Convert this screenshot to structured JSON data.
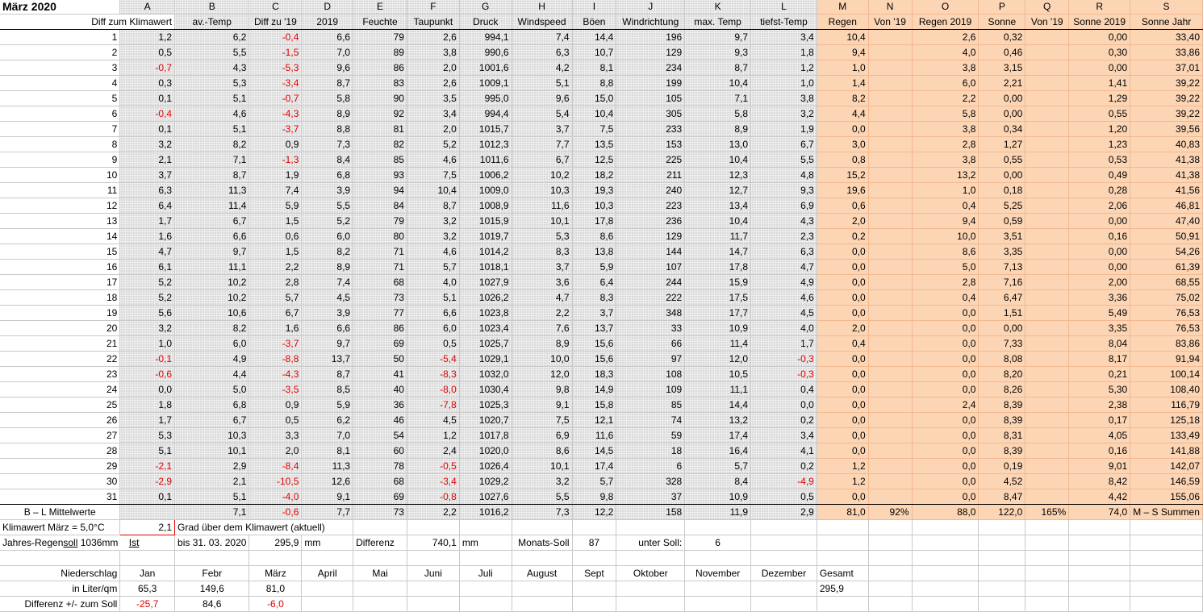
{
  "title": "März 2020",
  "col_letters": [
    "A",
    "B",
    "C",
    "D",
    "E",
    "F",
    "G",
    "H",
    "I",
    "J",
    "K",
    "L",
    "M",
    "N",
    "O",
    "P",
    "Q",
    "R",
    "S"
  ],
  "col_headers": [
    "Diff zum Klimawert",
    "av.-Temp",
    "Diff zu '19",
    "2019",
    "Feuchte",
    "Taupunkt",
    "Druck",
    "Windspeed",
    "Böen",
    "Windrichtung",
    "max. Temp",
    "tiefst-Temp",
    "Regen",
    "Von '19",
    "Regen 2019",
    "Sonne",
    "Von '19",
    "Sonne 2019",
    "Sonne Jahr"
  ],
  "rows": [
    [
      "1",
      "1,2",
      "6,2",
      "-0,4",
      "6,6",
      "79",
      "2,6",
      "994,1",
      "7,4",
      "14,4",
      "196",
      "9,7",
      "3,4",
      "10,4",
      "",
      "2,6",
      "0,32",
      "",
      "0,00",
      "33,40"
    ],
    [
      "2",
      "0,5",
      "5,5",
      "-1,5",
      "7,0",
      "89",
      "3,8",
      "990,6",
      "6,3",
      "10,7",
      "129",
      "9,3",
      "1,8",
      "9,4",
      "",
      "4,0",
      "0,46",
      "",
      "0,30",
      "33,86"
    ],
    [
      "3",
      "-0,7",
      "4,3",
      "-5,3",
      "9,6",
      "86",
      "2,0",
      "1001,6",
      "4,2",
      "8,1",
      "234",
      "8,7",
      "1,2",
      "1,0",
      "",
      "3,8",
      "3,15",
      "",
      "0,00",
      "37,01"
    ],
    [
      "4",
      "0,3",
      "5,3",
      "-3,4",
      "8,7",
      "83",
      "2,6",
      "1009,1",
      "5,1",
      "8,8",
      "199",
      "10,4",
      "1,0",
      "1,4",
      "",
      "6,0",
      "2,21",
      "",
      "1,41",
      "39,22"
    ],
    [
      "5",
      "0,1",
      "5,1",
      "-0,7",
      "5,8",
      "90",
      "3,5",
      "995,0",
      "9,6",
      "15,0",
      "105",
      "7,1",
      "3,8",
      "8,2",
      "",
      "2,2",
      "0,00",
      "",
      "1,29",
      "39,22"
    ],
    [
      "6",
      "-0,4",
      "4,6",
      "-4,3",
      "8,9",
      "92",
      "3,4",
      "994,4",
      "5,4",
      "10,4",
      "305",
      "5,8",
      "3,2",
      "4,4",
      "",
      "5,8",
      "0,00",
      "",
      "0,55",
      "39,22"
    ],
    [
      "7",
      "0,1",
      "5,1",
      "-3,7",
      "8,8",
      "81",
      "2,0",
      "1015,7",
      "3,7",
      "7,5",
      "233",
      "8,9",
      "1,9",
      "0,0",
      "",
      "3,8",
      "0,34",
      "",
      "1,20",
      "39,56"
    ],
    [
      "8",
      "3,2",
      "8,2",
      "0,9",
      "7,3",
      "82",
      "5,2",
      "1012,3",
      "7,7",
      "13,5",
      "153",
      "13,0",
      "6,7",
      "3,0",
      "",
      "2,8",
      "1,27",
      "",
      "1,23",
      "40,83"
    ],
    [
      "9",
      "2,1",
      "7,1",
      "-1,3",
      "8,4",
      "85",
      "4,6",
      "1011,6",
      "6,7",
      "12,5",
      "225",
      "10,4",
      "5,5",
      "0,8",
      "",
      "3,8",
      "0,55",
      "",
      "0,53",
      "41,38"
    ],
    [
      "10",
      "3,7",
      "8,7",
      "1,9",
      "6,8",
      "93",
      "7,5",
      "1006,2",
      "10,2",
      "18,2",
      "211",
      "12,3",
      "4,8",
      "15,2",
      "",
      "13,2",
      "0,00",
      "",
      "0,49",
      "41,38"
    ],
    [
      "11",
      "6,3",
      "11,3",
      "7,4",
      "3,9",
      "94",
      "10,4",
      "1009,0",
      "10,3",
      "19,3",
      "240",
      "12,7",
      "9,3",
      "19,6",
      "",
      "1,0",
      "0,18",
      "",
      "0,28",
      "41,56"
    ],
    [
      "12",
      "6,4",
      "11,4",
      "5,9",
      "5,5",
      "84",
      "8,7",
      "1008,9",
      "11,6",
      "10,3",
      "223",
      "13,4",
      "6,9",
      "0,6",
      "",
      "0,4",
      "5,25",
      "",
      "2,06",
      "46,81"
    ],
    [
      "13",
      "1,7",
      "6,7",
      "1,5",
      "5,2",
      "79",
      "3,2",
      "1015,9",
      "10,1",
      "17,8",
      "236",
      "10,4",
      "4,3",
      "2,0",
      "",
      "9,4",
      "0,59",
      "",
      "0,00",
      "47,40"
    ],
    [
      "14",
      "1,6",
      "6,6",
      "0,6",
      "6,0",
      "80",
      "3,2",
      "1019,7",
      "5,3",
      "8,6",
      "129",
      "11,7",
      "2,3",
      "0,2",
      "",
      "10,0",
      "3,51",
      "",
      "0,16",
      "50,91"
    ],
    [
      "15",
      "4,7",
      "9,7",
      "1,5",
      "8,2",
      "71",
      "4,6",
      "1014,2",
      "8,3",
      "13,8",
      "144",
      "14,7",
      "6,3",
      "0,0",
      "",
      "8,6",
      "3,35",
      "",
      "0,00",
      "54,26"
    ],
    [
      "16",
      "6,1",
      "11,1",
      "2,2",
      "8,9",
      "71",
      "5,7",
      "1018,1",
      "3,7",
      "5,9",
      "107",
      "17,8",
      "4,7",
      "0,0",
      "",
      "5,0",
      "7,13",
      "",
      "0,00",
      "61,39"
    ],
    [
      "17",
      "5,2",
      "10,2",
      "2,8",
      "7,4",
      "68",
      "4,0",
      "1027,9",
      "3,6",
      "6,4",
      "244",
      "15,9",
      "4,9",
      "0,0",
      "",
      "2,8",
      "7,16",
      "",
      "2,00",
      "68,55"
    ],
    [
      "18",
      "5,2",
      "10,2",
      "5,7",
      "4,5",
      "73",
      "5,1",
      "1026,2",
      "4,7",
      "8,3",
      "222",
      "17,5",
      "4,6",
      "0,0",
      "",
      "0,4",
      "6,47",
      "",
      "3,36",
      "75,02"
    ],
    [
      "19",
      "5,6",
      "10,6",
      "6,7",
      "3,9",
      "77",
      "6,6",
      "1023,8",
      "2,2",
      "3,7",
      "348",
      "17,7",
      "4,5",
      "0,0",
      "",
      "0,0",
      "1,51",
      "",
      "5,49",
      "76,53"
    ],
    [
      "20",
      "3,2",
      "8,2",
      "1,6",
      "6,6",
      "86",
      "6,0",
      "1023,4",
      "7,6",
      "13,7",
      "33",
      "10,9",
      "4,0",
      "2,0",
      "",
      "0,0",
      "0,00",
      "",
      "3,35",
      "76,53"
    ],
    [
      "21",
      "1,0",
      "6,0",
      "-3,7",
      "9,7",
      "69",
      "0,5",
      "1025,7",
      "8,9",
      "15,6",
      "66",
      "11,4",
      "1,7",
      "0,4",
      "",
      "0,0",
      "7,33",
      "",
      "8,04",
      "83,86"
    ],
    [
      "22",
      "-0,1",
      "4,9",
      "-8,8",
      "13,7",
      "50",
      "-5,4",
      "1029,1",
      "10,0",
      "15,6",
      "97",
      "12,0",
      "-0,3",
      "0,0",
      "",
      "0,0",
      "8,08",
      "",
      "8,17",
      "91,94"
    ],
    [
      "23",
      "-0,6",
      "4,4",
      "-4,3",
      "8,7",
      "41",
      "-8,3",
      "1032,0",
      "12,0",
      "18,3",
      "108",
      "10,5",
      "-0,3",
      "0,0",
      "",
      "0,0",
      "8,20",
      "",
      "0,21",
      "100,14"
    ],
    [
      "24",
      "0,0",
      "5,0",
      "-3,5",
      "8,5",
      "40",
      "-8,0",
      "1030,4",
      "9,8",
      "14,9",
      "109",
      "11,1",
      "0,4",
      "0,0",
      "",
      "0,0",
      "8,26",
      "",
      "5,30",
      "108,40"
    ],
    [
      "25",
      "1,8",
      "6,8",
      "0,9",
      "5,9",
      "36",
      "-7,8",
      "1025,3",
      "9,1",
      "15,8",
      "85",
      "14,4",
      "0,0",
      "0,0",
      "",
      "2,4",
      "8,39",
      "",
      "2,38",
      "116,79"
    ],
    [
      "26",
      "1,7",
      "6,7",
      "0,5",
      "6,2",
      "46",
      "4,5",
      "1020,7",
      "7,5",
      "12,1",
      "74",
      "13,2",
      "0,2",
      "0,0",
      "",
      "0,0",
      "8,39",
      "",
      "0,17",
      "125,18"
    ],
    [
      "27",
      "5,3",
      "10,3",
      "3,3",
      "7,0",
      "54",
      "1,2",
      "1017,8",
      "6,9",
      "11,6",
      "59",
      "17,4",
      "3,4",
      "0,0",
      "",
      "0,0",
      "8,31",
      "",
      "4,05",
      "133,49"
    ],
    [
      "28",
      "5,1",
      "10,1",
      "2,0",
      "8,1",
      "60",
      "2,4",
      "1020,0",
      "8,6",
      "14,5",
      "18",
      "16,4",
      "4,1",
      "0,0",
      "",
      "0,0",
      "8,39",
      "",
      "0,16",
      "141,88"
    ],
    [
      "29",
      "-2,1",
      "2,9",
      "-8,4",
      "11,3",
      "78",
      "-0,5",
      "1026,4",
      "10,1",
      "17,4",
      "6",
      "5,7",
      "0,2",
      "1,2",
      "",
      "0,0",
      "0,19",
      "",
      "9,01",
      "142,07"
    ],
    [
      "30",
      "-2,9",
      "2,1",
      "-10,5",
      "12,6",
      "68",
      "-3,4",
      "1029,2",
      "3,2",
      "5,7",
      "328",
      "8,4",
      "-4,9",
      "1,2",
      "",
      "0,0",
      "4,52",
      "",
      "8,42",
      "146,59"
    ],
    [
      "31",
      "0,1",
      "5,1",
      "-4,0",
      "9,1",
      "69",
      "-0,8",
      "1027,6",
      "5,5",
      "9,8",
      "37",
      "10,9",
      "0,5",
      "0,0",
      "",
      "0,0",
      "8,47",
      "",
      "4,42",
      "155,06"
    ]
  ],
  "mittel": {
    "label": "B – L Mittelwerte",
    "values": [
      "",
      "7,1",
      "-0,6",
      "7,7",
      "73",
      "2,2",
      "1016,2",
      "7,3",
      "12,2",
      "158",
      "11,9",
      "2,9",
      "81,0",
      "92%",
      "88,0",
      "122,0",
      "165%",
      "74,0"
    ],
    "summen_label": "M – S Summen"
  },
  "klima": {
    "label": "Klimawert März = 5,0°C",
    "value": "2,1",
    "text": "Grad über dem Klimawert (aktuell)"
  },
  "regen": {
    "soll_label": "Jahres-Regen",
    "soll_word": "soll",
    "soll_value": "1036mm",
    "ist_word": "Ist",
    "ist_date": "bis 31. 03. 2020",
    "ist_value": "295,9",
    "ist_unit": "mm",
    "diff_label": "Differenz",
    "diff_value": "740,1",
    "diff_unit": "mm",
    "monats_label": "Monats-Soll",
    "monats_value": "87",
    "unter_label": "unter Soll:",
    "unter_value": "6"
  },
  "monthly": {
    "label1": "Niederschlag",
    "label2": "in Liter/qm",
    "label3": "Differenz  +/- zum Soll",
    "months": [
      "Jan",
      "Febr",
      "März",
      "April",
      "Mai",
      "Juni",
      "Juli",
      "August",
      "Sept",
      "Oktober",
      "November",
      "Dezember",
      "Gesamt"
    ],
    "values": [
      "65,3",
      "149,6",
      "81,0",
      "",
      "",
      "",
      "",
      "",
      "",
      "",
      "",
      "",
      "295,9"
    ],
    "diffs": [
      "-25,7",
      "84,6",
      "-6,0",
      "",
      "",
      "",
      "",
      "",
      "",
      "",
      "",
      "",
      ""
    ]
  },
  "colors": {
    "negative": "#e00000",
    "orange": "#fcd5b4",
    "gray": "#eeeeee"
  }
}
